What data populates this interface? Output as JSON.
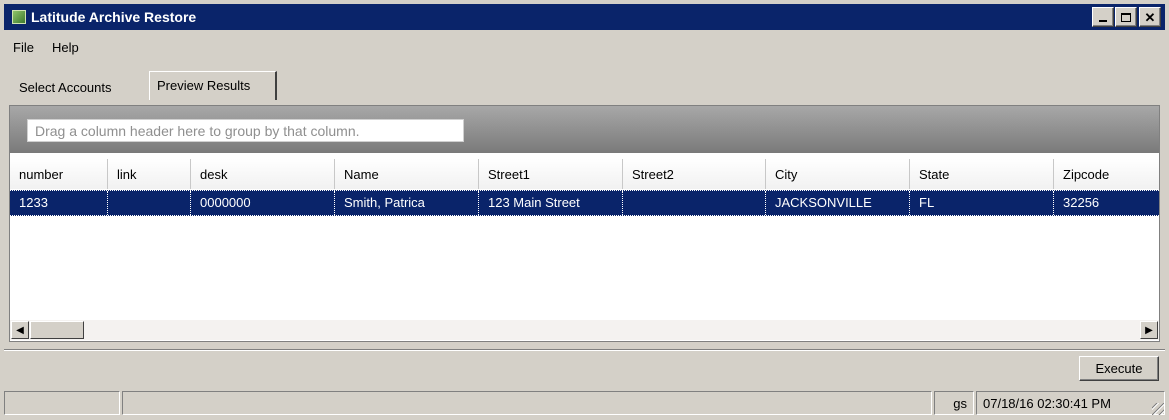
{
  "window": {
    "title": "Latitude Archive Restore"
  },
  "menu": {
    "items": [
      "File",
      "Help"
    ]
  },
  "tabs": [
    "Select Accounts",
    "Preview Results"
  ],
  "grid": {
    "group_hint": "Drag a column header here to group by that column.",
    "columns": [
      "number",
      "link",
      "desk",
      "Name",
      "Street1",
      "Street2",
      "City",
      "State",
      "Zipcode"
    ],
    "rows": [
      [
        "1233",
        "",
        "0000000",
        "Smith, Patrica",
        "123 Main Street",
        "",
        "JACKSONVILLE",
        "FL",
        "32256"
      ]
    ]
  },
  "actions": {
    "execute_label": "Execute"
  },
  "status": {
    "user": "gs",
    "datetime": "07/18/16 02:30:41 PM"
  },
  "colors": {
    "titlebar": "#0a246a",
    "selection": "#0a246a",
    "chrome": "#d4d0c8"
  }
}
